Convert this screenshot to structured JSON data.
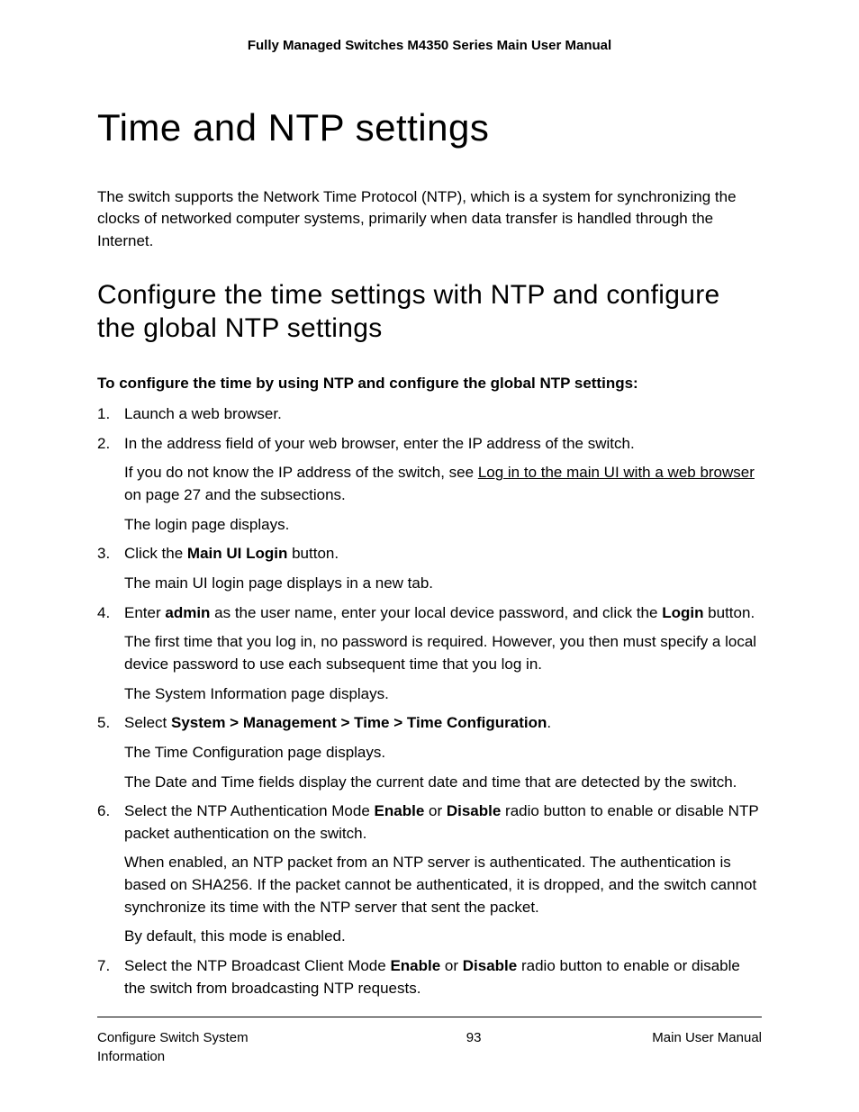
{
  "header": {
    "title": "Fully Managed Switches M4350 Series Main User Manual"
  },
  "main": {
    "h1": "Time and NTP settings",
    "intro": "The switch supports the Network Time Protocol (NTP), which is a system for synchronizing the clocks of networked computer systems, primarily when data transfer is handled through the Internet.",
    "h2": "Configure the time settings with NTP and configure the global NTP settings",
    "lead": "To configure the time by using NTP and configure the global NTP settings:",
    "steps": {
      "s1": "Launch a web browser.",
      "s2": {
        "main": "In the address field of your web browser, enter the IP address of the switch.",
        "p1a": "If you do not know the IP address of the switch, see ",
        "p1link": "Log in to the main UI with a web browser",
        "p1b": " on page 27 and the subsections.",
        "p2": "The login page displays."
      },
      "s3": {
        "a": "Click the ",
        "b": "Main UI Login",
        "c": " button.",
        "p1": "The main UI login page displays in a new tab."
      },
      "s4": {
        "a": "Enter ",
        "b": "admin",
        "c": " as the user name, enter your local device password, and click the ",
        "d": "Login",
        "e": " button.",
        "p1": "The first time that you log in, no password is required. However, you then must specify a local device password to use each subsequent time that you log in.",
        "p2": "The System Information page displays."
      },
      "s5": {
        "a": "Select ",
        "b": "System > Management > Time > Time Configuration",
        "c": ".",
        "p1": "The Time Configuration page displays.",
        "p2": "The Date and Time fields display the current date and time that are detected by the switch."
      },
      "s6": {
        "a": "Select the NTP Authentication Mode ",
        "b": "Enable",
        "c": " or ",
        "d": "Disable",
        "e": " radio button to enable or disable NTP packet authentication on the switch.",
        "p1": "When enabled, an NTP packet from an NTP server is authenticated. The authentication is based on SHA256. If the packet cannot be authenticated, it is dropped, and the switch cannot synchronize its time with the NTP server that sent the packet.",
        "p2": "By default, this mode is enabled."
      },
      "s7": {
        "a": "Select the NTP Broadcast Client Mode ",
        "b": "Enable",
        "c": " or ",
        "d": "Disable",
        "e": " radio button to enable or disable the switch from broadcasting NTP requests."
      }
    }
  },
  "footer": {
    "left": "Configure Switch System Information",
    "center": "93",
    "right": "Main User Manual"
  }
}
